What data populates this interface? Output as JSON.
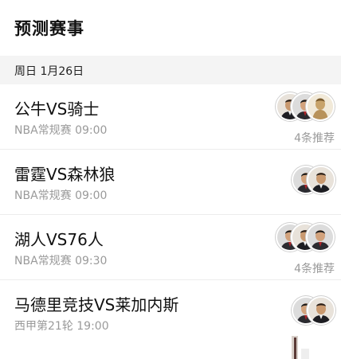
{
  "header": {
    "title": "预测赛事"
  },
  "date_bar": {
    "label": "周日 1月26日"
  },
  "matches": [
    {
      "title": "公牛VS骑士",
      "subtitle": "NBA常规赛 09:00",
      "recommend": "4条推荐",
      "avatars": [
        "avatar-man-glasses",
        "avatar-man-suit",
        "avatar-gold-figure"
      ]
    },
    {
      "title": "雷霆VS森林狼",
      "subtitle": "NBA常规赛 09:00",
      "recommend": "",
      "avatars": [
        "avatar-man-suit",
        "avatar-man-glasses"
      ]
    },
    {
      "title": "湖人VS76人",
      "subtitle": "NBA常规赛 09:30",
      "recommend": "4条推荐",
      "avatars": [
        "avatar-man-suit",
        "avatar-man-glasses",
        "avatar-man-suit"
      ]
    },
    {
      "title": "马德里竞技VS莱加内斯",
      "subtitle": "西甲第21轮 19:00",
      "recommend": "",
      "avatars": [
        "avatar-man-suit",
        "avatar-man-glasses"
      ]
    }
  ],
  "colors": {
    "title_text": "#111111",
    "sub_text": "#9a9a9a",
    "date_bar_bg": "#f4f4f4",
    "divider": "#ececec"
  }
}
